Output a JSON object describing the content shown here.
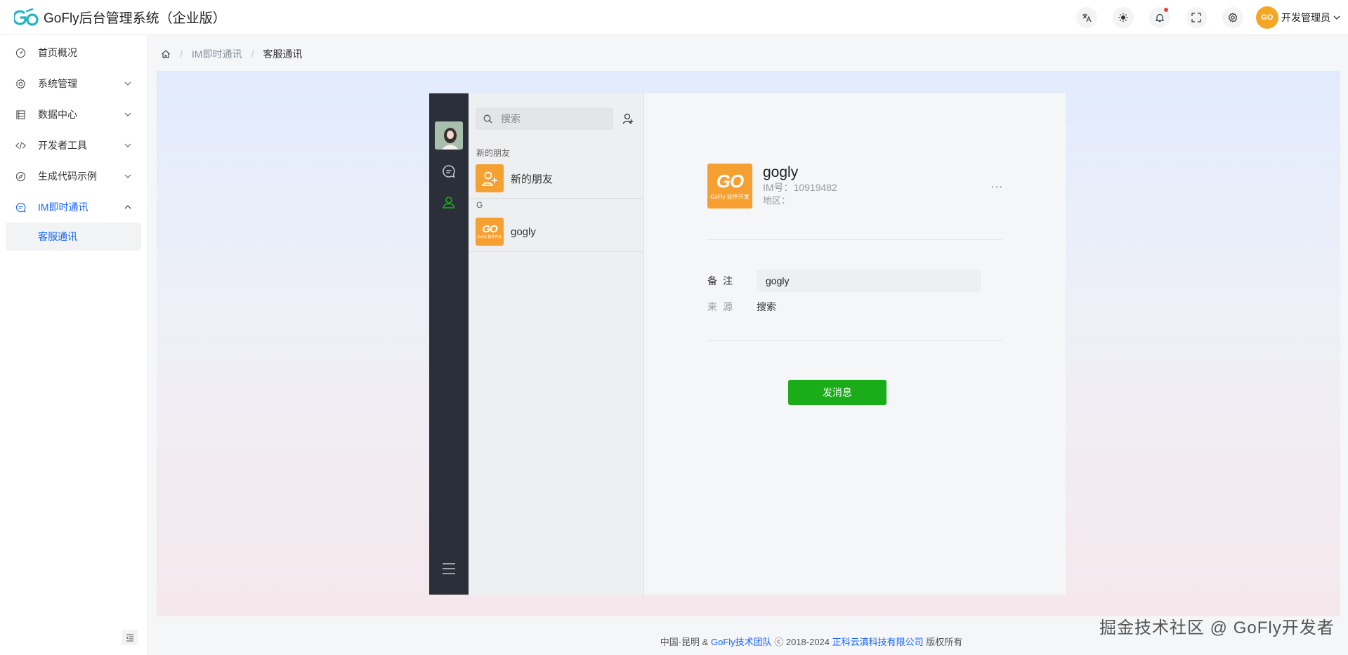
{
  "header": {
    "app_title": "GoFly后台管理系统（企业版）",
    "icons": [
      "translate-icon",
      "theme-icon",
      "bell-icon",
      "fullscreen-icon",
      "settings-icon"
    ],
    "user_name": "开发管理员",
    "user_avatar_text": "GO"
  },
  "sidebar": {
    "items": [
      {
        "label": "首页概况",
        "icon": "dashboard-icon"
      },
      {
        "label": "系统管理",
        "icon": "gear-icon"
      },
      {
        "label": "数据中心",
        "icon": "database-icon"
      },
      {
        "label": "开发者工具",
        "icon": "code-icon"
      },
      {
        "label": "生成代码示例",
        "icon": "compass-icon"
      },
      {
        "label": "IM即时通讯",
        "icon": "chat-icon"
      }
    ],
    "sub_item": "客服通讯"
  },
  "breadcrumb": {
    "items": [
      "IM即时通讯",
      "客服通讯"
    ]
  },
  "chat": {
    "search_placeholder": "搜索",
    "new_friends_group": "新的朋友",
    "new_friends_label": "新的朋友",
    "letter_group": "G",
    "contact_name": "gogly",
    "avatar_logo": "GO",
    "avatar_caption": "GoFly 软件开发"
  },
  "profile": {
    "name": "gogly",
    "im_id": "IM号：10919482",
    "region": "地区：",
    "more": "···",
    "remark_label": "备注",
    "remark_value": "gogly",
    "source_label": "来源",
    "source_value": "搜索",
    "send_button": "发消息"
  },
  "footer": {
    "prefix": "中国·昆明 & ",
    "team": "GoFly技术团队",
    "middle": " ⓒ 2018-2024 ",
    "company": "正科云滇科技有限公司",
    "suffix": " 版权所有"
  },
  "watermark": "掘金技术社区 @ GoFly开发者",
  "colors": {
    "accent": "#1664ff",
    "send_button": "#1aad19",
    "rail": "#2a2f3a",
    "avatar_orange": "#f5a031"
  }
}
